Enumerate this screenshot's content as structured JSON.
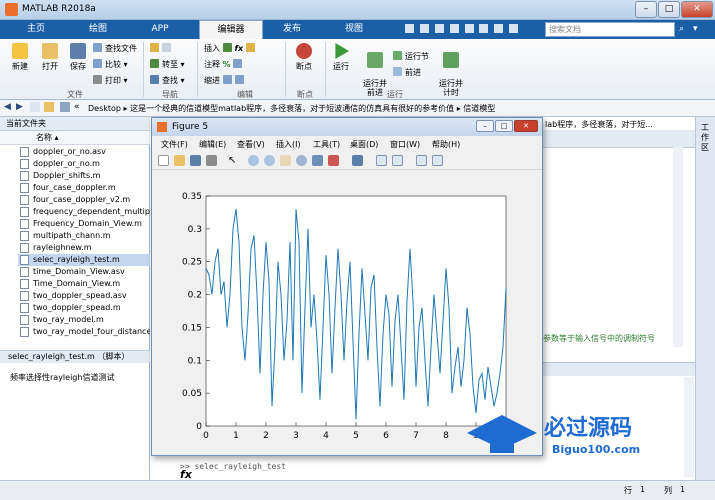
{
  "window": {
    "title": "MATLAB R2018a"
  },
  "ribbon": {
    "tabs": [
      "主页",
      "绘图",
      "APP",
      "编辑器",
      "发布",
      "视图"
    ],
    "active_tab": "编辑器",
    "search_placeholder": "搜索文档",
    "file_group": {
      "new": "新建",
      "open": "打开",
      "save": "保存",
      "find_files": "查找文件",
      "compare": "比较",
      "print": "打印",
      "label": "文件"
    },
    "nav_group": {
      "goto": "转至",
      "find": "查找",
      "label": "导航"
    },
    "edit_group": {
      "insert": "插入",
      "comment": "注释",
      "indent": "缩进",
      "label": "编辑"
    },
    "breakpoint_group": {
      "breakpoints": "断点",
      "label": "断点"
    },
    "run_group": {
      "run": "运行",
      "run_advance": "运行并\n前进",
      "run_section": "运行节",
      "advance": "前进",
      "run_time": "运行并\n计时",
      "label": "运行"
    }
  },
  "address": {
    "root": "Desktop",
    "folder1": "这是一个经典的信道模型matlab程序，多径衰落，对于短波通信的仿真具有很好的参考价值",
    "folder2": "信道模型"
  },
  "left_panel": {
    "title": "当前文件夹",
    "col_name": "名称",
    "files": [
      "doppler_or_no.asv",
      "doppler_or_no.m",
      "Doppler_shifts.m",
      "four_case_doppler.m",
      "four_case_doppler_v2.m",
      "frequency_dependent_multipa",
      "Frequency_Domain_View.m",
      "multipath_chann.m",
      "rayleighnew.m",
      "selec_rayleigh_test.m",
      "time_Domain_View.asv",
      "Time_Domain_View.m",
      "two_doppler_spead.asv",
      "two_doppler_spead.m",
      "two_ray_model.m",
      "two_ray_model_four_distance"
    ],
    "selected_file": "selec_rayleigh_test.m",
    "detail_title": "selec_rayleigh_test.m （脚本）",
    "detail_text": "频率选择性rayleigh信道测试"
  },
  "editor": {
    "bg_text": "lab程序，多径衰落，对于短...",
    "snippet": "参数等于输入信号中的调制符号"
  },
  "command": {
    "prompt": "fx",
    "text": ">> selec_rayleigh_test"
  },
  "status": {
    "row_label": "行",
    "row": "1",
    "col_label": "列",
    "col": "1"
  },
  "right_strip": {
    "label": "工作区"
  },
  "figure": {
    "title": "Figure 5",
    "menu": [
      "文件(F)",
      "编辑(E)",
      "查看(V)",
      "插入(I)",
      "工具(T)",
      "桌面(D)",
      "窗口(W)",
      "帮助(H)"
    ]
  },
  "chart_data": {
    "type": "line",
    "title": "",
    "xlabel": "",
    "ylabel": "",
    "xlim": [
      0,
      10
    ],
    "ylim": [
      0,
      0.35
    ],
    "xticks": [
      "0",
      "1",
      "2",
      "3",
      "4",
      "5",
      "6",
      "7",
      "8",
      "9"
    ],
    "yticks": [
      "0",
      "0.05",
      "0.1",
      "0.15",
      "0.2",
      "0.25",
      "0.3",
      "0.35"
    ],
    "grid": false,
    "color": "#1f77b4",
    "series": [
      {
        "x": [
          0,
          0.1,
          0.2,
          0.3,
          0.4,
          0.5,
          0.6,
          0.7,
          0.8,
          0.9,
          1.0,
          1.1,
          1.2,
          1.3,
          1.4,
          1.5,
          1.6,
          1.7,
          1.8,
          1.9,
          2.0,
          2.1,
          2.2,
          2.3,
          2.4,
          2.5,
          2.6,
          2.7,
          2.8,
          2.9,
          3.0,
          3.1,
          3.2,
          3.3,
          3.4,
          3.5,
          3.6,
          3.7,
          3.8,
          3.9,
          4.0,
          4.1,
          4.2,
          4.3,
          4.4,
          4.5,
          4.6,
          4.7,
          4.8,
          4.9,
          5.0,
          5.1,
          5.2,
          5.3,
          5.4,
          5.5,
          5.6,
          5.7,
          5.8,
          5.9,
          6.0,
          6.1,
          6.2,
          6.3,
          6.4,
          6.5,
          6.6,
          6.7,
          6.8,
          6.9,
          7.0,
          7.1,
          7.2,
          7.3,
          7.4,
          7.5,
          7.6,
          7.7,
          7.8,
          7.9,
          8.0,
          8.1,
          8.2,
          8.3,
          8.4,
          8.5,
          8.6,
          8.7,
          8.8,
          8.9,
          9.0,
          9.1,
          9.2,
          9.3,
          9.4,
          9.5,
          9.6,
          9.7,
          9.8,
          9.9,
          10.0
        ],
        "y": [
          0.24,
          0.23,
          0.2,
          0.25,
          0.27,
          0.2,
          0.22,
          0.15,
          0.2,
          0.3,
          0.33,
          0.28,
          0.15,
          0.1,
          0.17,
          0.27,
          0.29,
          0.2,
          0.08,
          0.2,
          0.28,
          0.22,
          0.03,
          0.12,
          0.25,
          0.2,
          0.1,
          0.16,
          0.28,
          0.1,
          0.33,
          0.28,
          0.05,
          0.18,
          0.3,
          0.15,
          0.2,
          0.13,
          0.04,
          0.15,
          0.26,
          0.2,
          0.08,
          0.18,
          0.27,
          0.2,
          0.1,
          0.19,
          0.25,
          0.13,
          0.01,
          0.14,
          0.24,
          0.17,
          0.1,
          0.21,
          0.23,
          0.12,
          0.03,
          0.14,
          0.2,
          0.17,
          0.06,
          0.16,
          0.2,
          0.12,
          0.04,
          0.19,
          0.27,
          0.19,
          0.06,
          0.15,
          0.18,
          0.1,
          0.03,
          0.12,
          0.2,
          0.14,
          0.08,
          0.16,
          0.24,
          0.18,
          0.05,
          0.09,
          0.12,
          0.06,
          0.1,
          0.18,
          0.14,
          0.06,
          0.02,
          0.07,
          0.08,
          0.04,
          0.09,
          0.06,
          0.03,
          0.05,
          0.08,
          0.12,
          0.21
        ]
      }
    ]
  }
}
